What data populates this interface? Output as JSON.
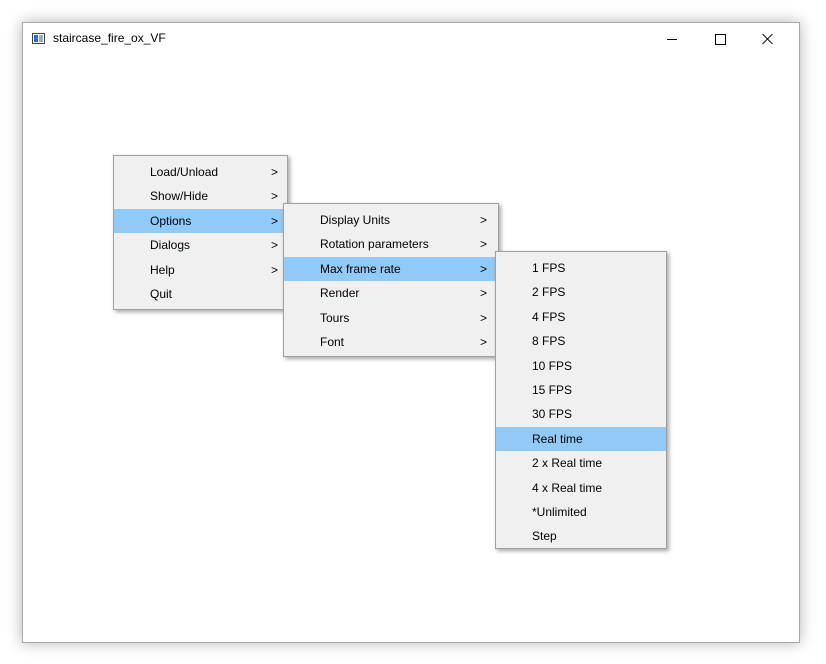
{
  "window": {
    "title": "staircase_fire_ox_VF",
    "icon": "app-window-icon",
    "controls": [
      "minimize-icon",
      "maximize-icon",
      "close-icon"
    ]
  },
  "main_menu": {
    "items": [
      {
        "label": "Load/Unload",
        "arrow": ">"
      },
      {
        "label": "Show/Hide",
        "arrow": ">"
      },
      {
        "label": "Options",
        "arrow": ">"
      },
      {
        "label": "Dialogs",
        "arrow": ">"
      },
      {
        "label": "Help",
        "arrow": ">"
      },
      {
        "label": "Quit",
        "arrow": ""
      }
    ],
    "highlighted": "Options"
  },
  "options_menu": {
    "items": [
      {
        "label": "Display Units",
        "arrow": ">"
      },
      {
        "label": "Rotation parameters",
        "arrow": ">"
      },
      {
        "label": "Max frame rate",
        "arrow": ">"
      },
      {
        "label": "Render",
        "arrow": ">"
      },
      {
        "label": "Tours",
        "arrow": ">"
      },
      {
        "label": "Font",
        "arrow": ">"
      }
    ],
    "highlighted": "Max frame rate"
  },
  "frame_rate_menu": {
    "items": [
      {
        "label": "1 FPS"
      },
      {
        "label": "2 FPS"
      },
      {
        "label": "4 FPS"
      },
      {
        "label": "8 FPS"
      },
      {
        "label": "10 FPS"
      },
      {
        "label": "15 FPS"
      },
      {
        "label": "30 FPS"
      },
      {
        "label": "Real time"
      },
      {
        "label": "2 x Real time"
      },
      {
        "label": "4 x Real time"
      },
      {
        "label": "*Unlimited"
      },
      {
        "label": "Step"
      }
    ],
    "highlighted": "Real time"
  },
  "colors": {
    "menu_bg": "#f0f0f0",
    "highlight": "#91c9f7",
    "building_fill": "#777777",
    "stairs": "#e6e6e6",
    "fire_marker": "#f0b030"
  }
}
